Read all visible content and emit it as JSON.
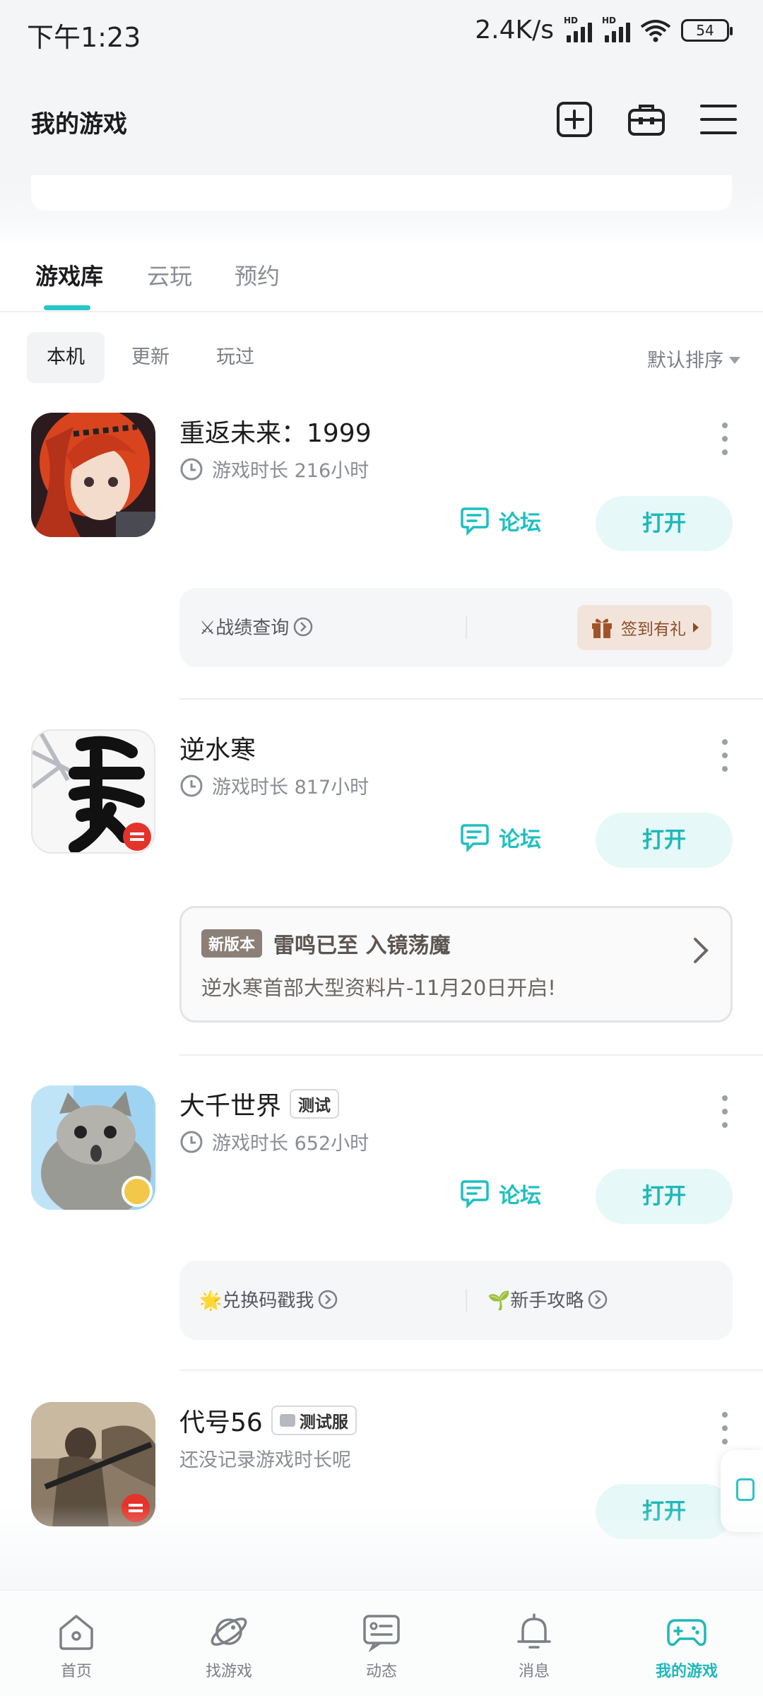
{
  "status_bar": {
    "time": "下午1:23",
    "speed": "2.4K/s",
    "hd": "HD",
    "battery": "54"
  },
  "header": {
    "title": "我的游戏",
    "icons": [
      "add-icon",
      "toolbox-icon",
      "menu-icon"
    ]
  },
  "tabs": [
    {
      "label": "游戏库",
      "active": true
    },
    {
      "label": "云玩",
      "active": false
    },
    {
      "label": "预约",
      "active": false
    }
  ],
  "filters": {
    "chips": [
      {
        "label": "本机",
        "active": true
      },
      {
        "label": "更新",
        "active": false
      },
      {
        "label": "玩过",
        "active": false
      }
    ],
    "sort_label": "默认排序"
  },
  "games": [
    {
      "name": "重返未来：1999",
      "playtime": "游戏时长 216小时",
      "forum_label": "论坛",
      "open_label": "打开",
      "panel": {
        "left": "⚔战绩查询",
        "gift": "签到有礼"
      }
    },
    {
      "name": "逆水寒",
      "playtime": "游戏时长 817小时",
      "forum_label": "论坛",
      "open_label": "打开",
      "news": {
        "badge": "新版本",
        "title": "雷鸣已至 入镜荡魔",
        "desc": "逆水寒首部大型资料片-11月20日开启!"
      }
    },
    {
      "name": "大千世界",
      "tag": "测试",
      "playtime": "游戏时长 652小时",
      "forum_label": "论坛",
      "open_label": "打开",
      "panel": {
        "left": "🌟兑换码戳我",
        "right": "🌱新手攻略"
      }
    },
    {
      "name": "代号56",
      "tag": "测试服",
      "playtime": "还没记录游戏时长呢",
      "open_label": "打开"
    }
  ],
  "bottom_nav": [
    {
      "label": "首页",
      "icon": "home-icon",
      "active": false
    },
    {
      "label": "找游戏",
      "icon": "planet-icon",
      "active": false
    },
    {
      "label": "动态",
      "icon": "feed-icon",
      "active": false
    },
    {
      "label": "消息",
      "icon": "bell-icon",
      "active": false
    },
    {
      "label": "我的游戏",
      "icon": "gamepad-icon",
      "active": true
    }
  ],
  "colors": {
    "accent": "#24c6c8",
    "open_bg": "#e6f8f8",
    "gift_bg": "#f3e4db"
  }
}
